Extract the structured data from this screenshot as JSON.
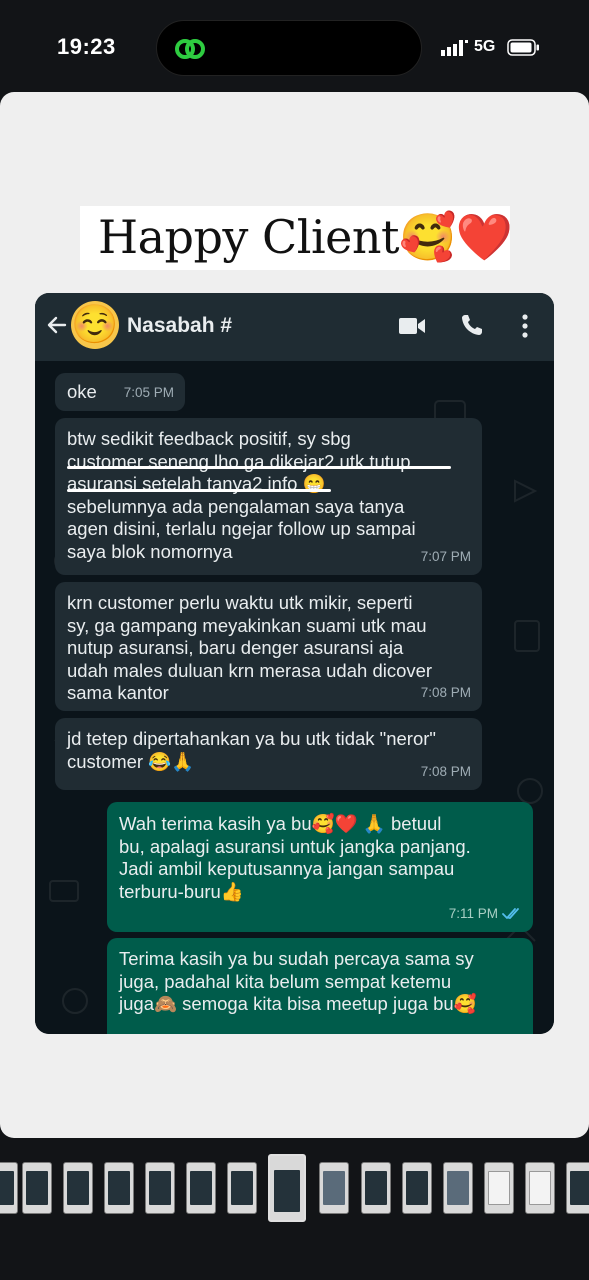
{
  "status_bar": {
    "time": "19:23",
    "network": "5G"
  },
  "story": {
    "title": "Happy Client🥰❤️"
  },
  "chat": {
    "contact_avatar": "☺️",
    "contact_name": "Nasabah #",
    "messages": [
      {
        "dir": "in",
        "text": "oke",
        "time": "7:05 PM"
      },
      {
        "dir": "in",
        "text": "btw sedikit feedback positif, sy sbg\ncustomer seneng lho ga dikejar2 utk tutup\nasuransi setelah tanya2 info 😁\nsebelumnya ada pengalaman saya tanya\nagen disini, terlalu ngejar follow up sampai\nsaya blok nomornya",
        "time": "7:07 PM"
      },
      {
        "dir": "in",
        "text": "krn customer perlu waktu utk mikir, seperti\nsy, ga gampang meyakinkan suami utk mau\nnutup asuransi, baru denger asuransi aja\nudah males duluan krn merasa udah dicover\nsama kantor",
        "time": "7:08 PM"
      },
      {
        "dir": "in",
        "text": "jd tetep dipertahankan ya bu utk tidak \"neror\"\ncustomer 😂🙏",
        "time": "7:08 PM"
      },
      {
        "dir": "out",
        "text": "Wah terima kasih ya bu🥰❤️ 🙏  betuul\nbu, apalagi asuransi untuk jangka panjang.\nJadi ambil keputusannya jangan sampau\nterburu-buru👍",
        "time": "7:11 PM"
      },
      {
        "dir": "out",
        "text": "Terima kasih ya bu sudah percaya sama sy\njuga, padahal kita belum sempat ketemu\njuga🙈 semoga kita bisa meetup juga bu🥰",
        "time": ""
      }
    ]
  },
  "icons": {
    "back": "arrow-left-icon",
    "video": "video-call-icon",
    "call": "phone-icon",
    "menu": "more-vertical-icon",
    "read": "double-check-icon"
  },
  "colors": {
    "incoming_bubble": "#202c33",
    "outgoing_bubble": "#005c4b",
    "chat_header": "#1f2c33",
    "chat_bg": "#0b141a",
    "read_tick": "#53bdeb"
  }
}
